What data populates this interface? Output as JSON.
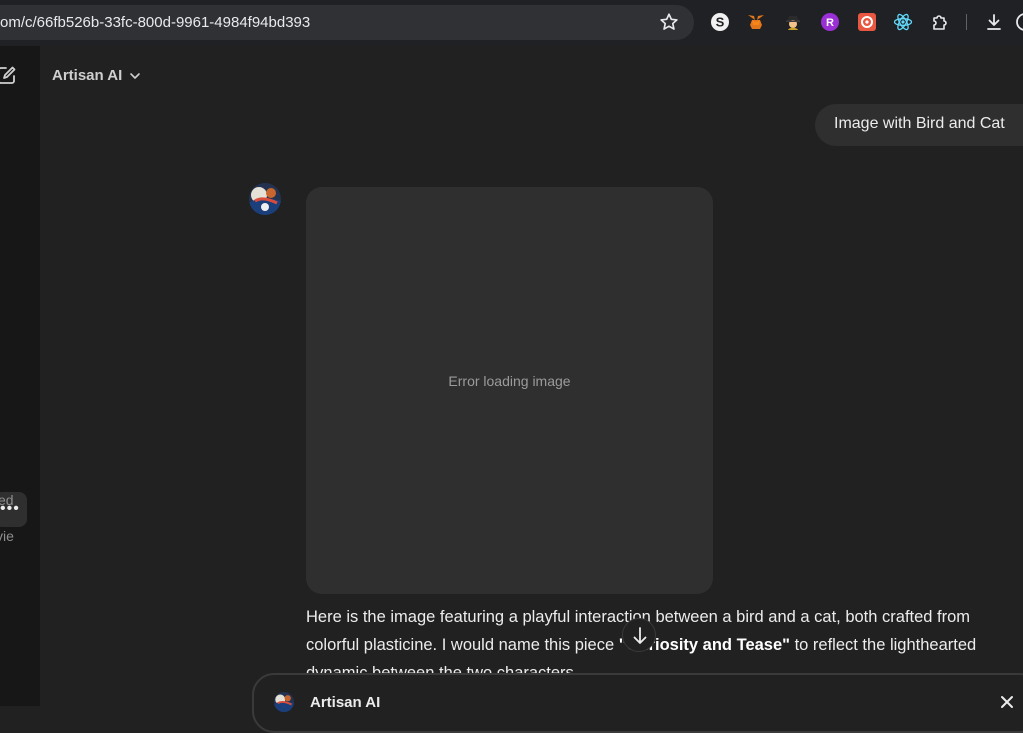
{
  "browser": {
    "url": "om/c/66fb526b-33fc-800d-9961-4984f94bd393",
    "icons": [
      "star-icon",
      "s-extension-icon",
      "metamask-icon",
      "spy-extension-icon",
      "purple-r-extension-icon",
      "red-extension-icon",
      "react-devtools-icon",
      "extensions-puzzle-icon",
      "download-icon"
    ]
  },
  "sidebar": {
    "more_label": "•••",
    "frag1": "ed",
    "frag2": "vie"
  },
  "header": {
    "model_name": "Artisan AI"
  },
  "conversation": {
    "user_message": "Image with Bird and Cat",
    "image_error": "Error loading image",
    "reply_part1": "Here is the image featuring a playful interaction between a bird and a cat, both crafted from colorful plasticine. I would name this piece ",
    "reply_bold": "\"Curiosity and Tease\"",
    "reply_part2": " to reflect the lighthearted dynamic between the two characters."
  },
  "bottom_bar": {
    "name": "Artisan AI"
  }
}
